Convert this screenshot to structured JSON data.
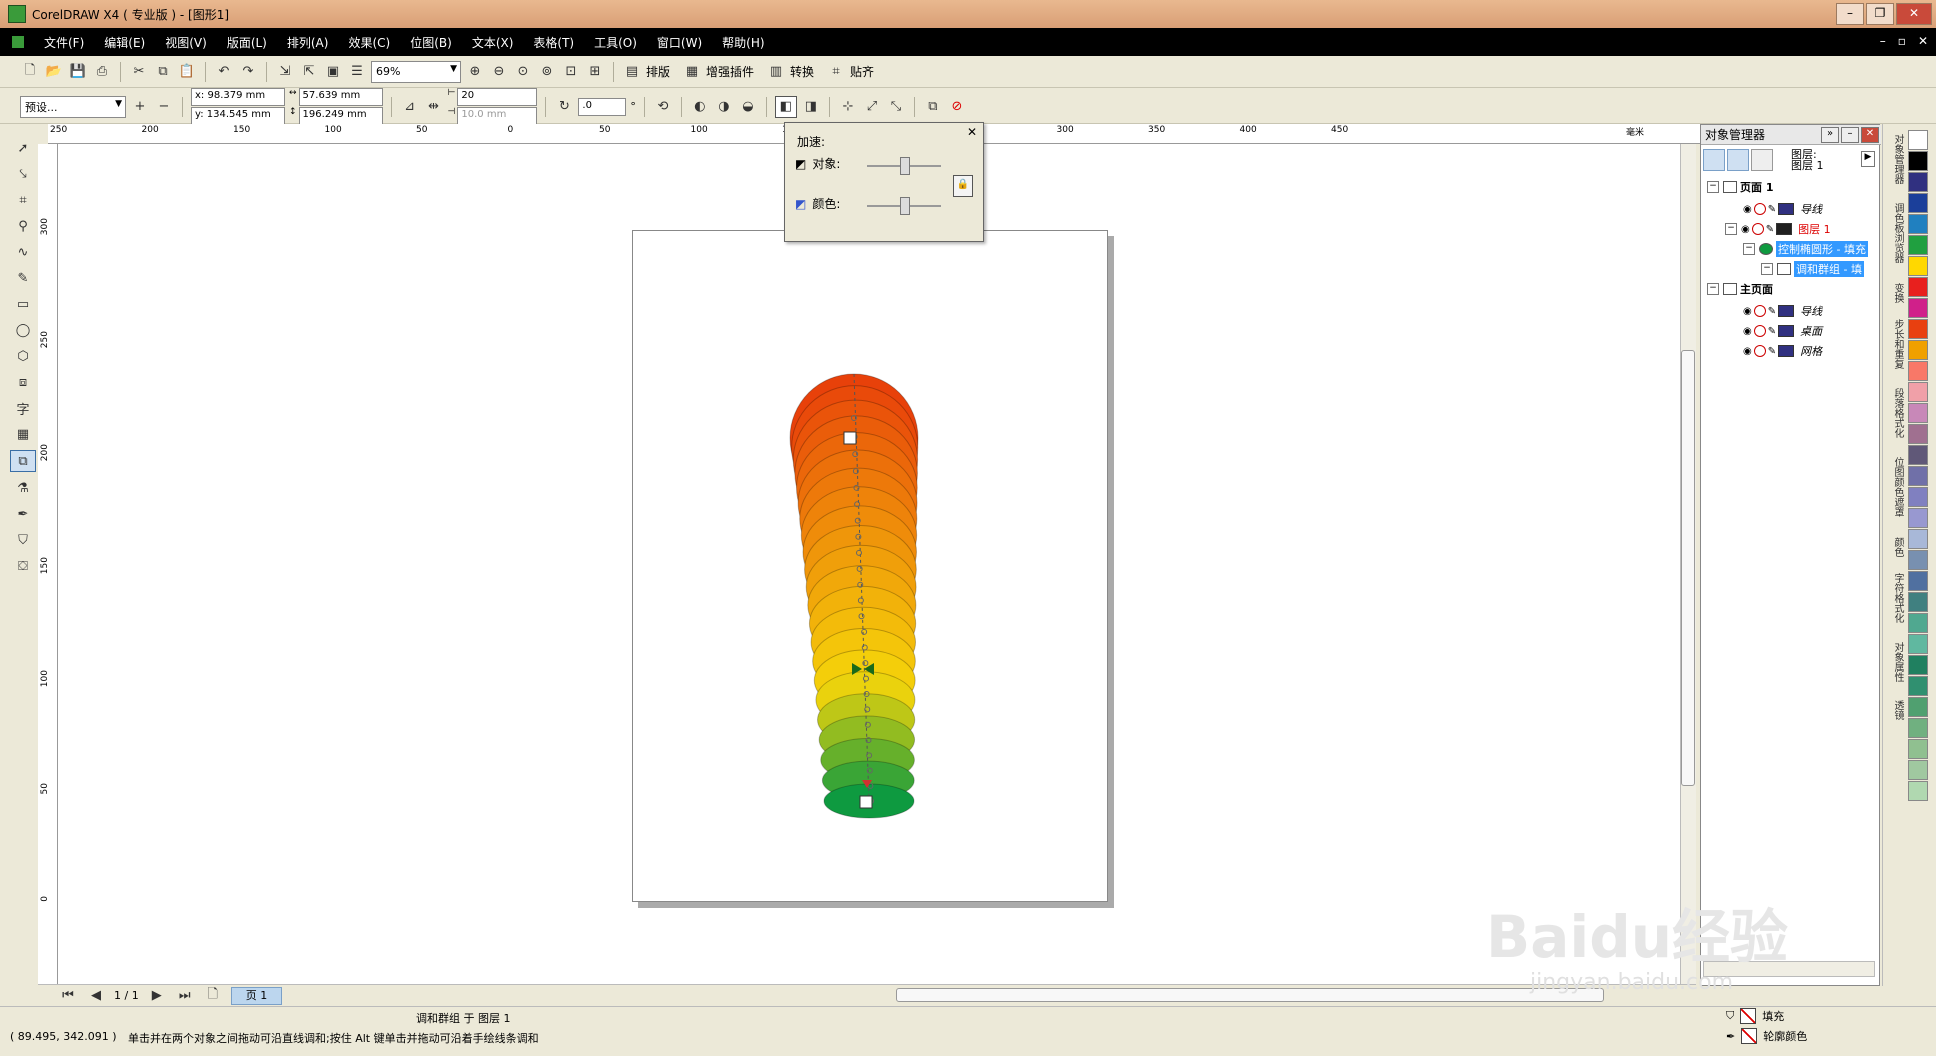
{
  "window": {
    "title": "CorelDRAW X4 ( 专业版 ) - [图形1]"
  },
  "menu": [
    "文件(F)",
    "编辑(E)",
    "视图(V)",
    "版面(L)",
    "排列(A)",
    "效果(C)",
    "位图(B)",
    "文本(X)",
    "表格(T)",
    "工具(O)",
    "窗口(W)",
    "帮助(H)"
  ],
  "toolbar": {
    "zoom": "69%",
    "buttons": [
      "排版",
      "增强插件",
      "转换",
      "贴齐"
    ]
  },
  "property_bar": {
    "preset": "预设...",
    "x": "x: 98.379 mm",
    "y": "y: 134.545 mm",
    "width": "57.639 mm",
    "height": "196.249 mm",
    "steps": "20",
    "offset": "10.0 mm",
    "angle": ".0",
    "angle_unit": "°"
  },
  "ruler": {
    "h_labels": [
      "250",
      "200",
      "150",
      "100",
      "50",
      "0",
      "50",
      "100",
      "150",
      "200",
      "250",
      "300",
      "350",
      "400",
      "450"
    ],
    "h_unit": "毫米",
    "v_labels": [
      "300",
      "250",
      "200",
      "150",
      "100",
      "50",
      "0"
    ]
  },
  "accel_popup": {
    "title": "加速:",
    "object_label": "对象:",
    "color_label": "颜色:",
    "object_value": 0.5,
    "color_value": 0.5
  },
  "object_manager": {
    "title": "对象管理器",
    "layer_label": "图层:",
    "layer_value": "图层 1",
    "rows": [
      {
        "label": "页面 1",
        "level": 0,
        "bold": true
      },
      {
        "label": "导线",
        "level": 2,
        "italic": true
      },
      {
        "label": "图层 1",
        "level": 1,
        "red": true
      },
      {
        "label": "控制椭圆形 - 填充",
        "level": 2,
        "selected": true
      },
      {
        "label": "调和群组 - 填",
        "level": 3,
        "selected": true
      },
      {
        "label": "主页面",
        "level": 0,
        "bold": true
      },
      {
        "label": "导线",
        "level": 2,
        "italic": true
      },
      {
        "label": "桌面",
        "level": 2,
        "italic": true
      },
      {
        "label": "网格",
        "level": 2,
        "italic": true
      }
    ]
  },
  "side_tabs": [
    "对象管理器",
    "调色板浏览器",
    "变换",
    "步长和重复",
    "段落格式化",
    "位图颜色遮罩",
    "颜色",
    "字符格式化",
    "对象属性",
    "透镜"
  ],
  "page_nav": {
    "page_count": "1 / 1",
    "page_tab": "页 1"
  },
  "status": {
    "selection": "调和群组 于 图层 1",
    "coords": "( 89.495, 342.091 )",
    "hint": "单击并在两个对象之间拖动可沿直线调和;按住 Alt 键单击并拖动可沿着手绘线条调和",
    "fill_label": "填充",
    "outline_label": "轮廓颜色"
  },
  "blend": {
    "start_color": "#e8410a",
    "mid_color": "#f5d50a",
    "end_color": "#0e9a40",
    "steps": 20
  },
  "palette_colors": [
    "#ffffff",
    "#000000",
    "#303080",
    "#1b3f9a",
    "#2080c0",
    "#20a040",
    "#ffd800",
    "#e8201e",
    "#d0208a",
    "#e84010",
    "#f0a000",
    "#f87868",
    "#f0a0a8",
    "#c888b8",
    "#a07090",
    "#605878",
    "#7070a8",
    "#8080c0",
    "#9898d0",
    "#a8b8d8",
    "#7890b0",
    "#5070a0",
    "#408080",
    "#50a890",
    "#60b8a0",
    "#208060",
    "#309070",
    "#50a070",
    "#70b080",
    "#90c090",
    "#a0c8a0",
    "#b0d8b0"
  ],
  "watermark": "Baidu经验",
  "watermark_sub": "jingyan.baidu.com"
}
